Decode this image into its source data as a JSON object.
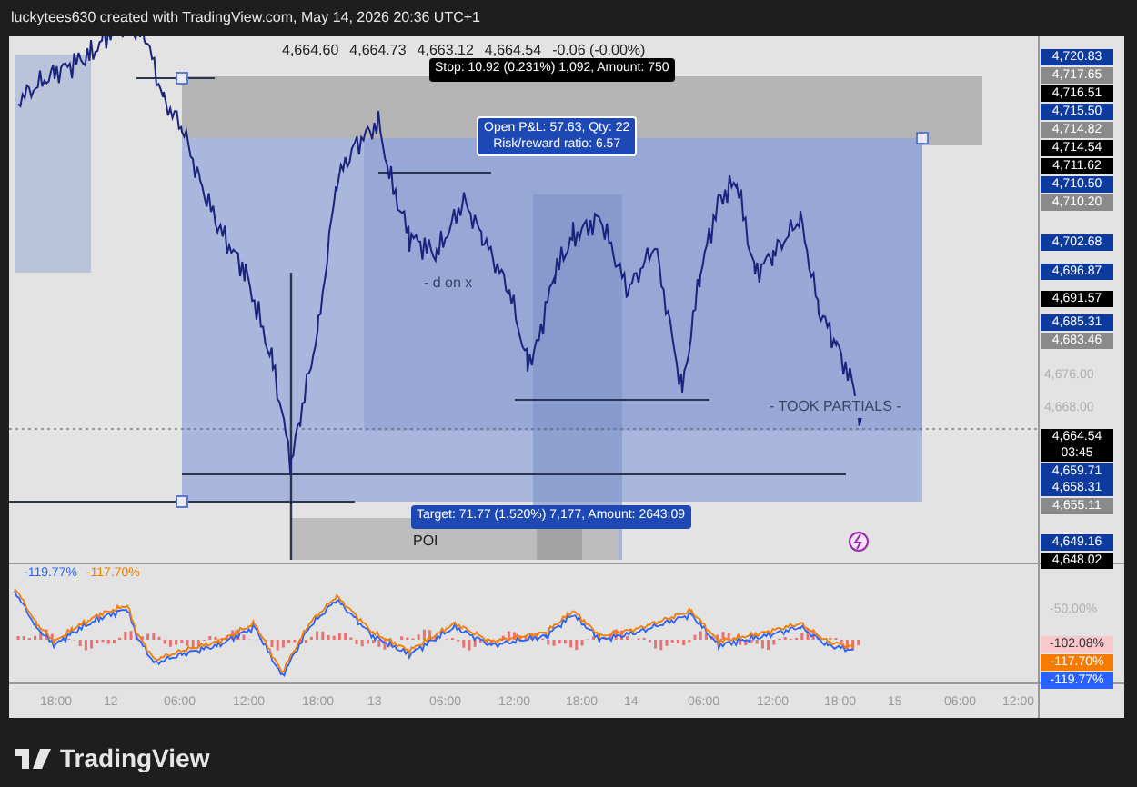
{
  "header": {
    "title": "luckytees630 created with TradingView.com, May 14, 2026 20:36 UTC+1"
  },
  "ohlc": [
    "4,664.60",
    "4,664.73",
    "4,663.12",
    "4,664.54",
    "-0.06 (-0.00%)"
  ],
  "annotations": {
    "stop": "Stop: 10.92 (0.231%) 1,092, Amount: 750",
    "open_pnl": "Open P&L: 57.63, Qty: 22",
    "risk_reward": "Risk/reward ratio: 6.57",
    "target": "Target: 71.77 (1.520%) 7,177, Amount: 2643.09",
    "note_left": "- d on x",
    "note_right": "- TOOK PARTIALS -",
    "zone": "POI"
  },
  "price_axis": [
    {
      "kind": "tag",
      "text": "4,720.83",
      "color": "#0d3a9e"
    },
    {
      "kind": "tag",
      "text": "4,717.65",
      "color": "#8a8a8a"
    },
    {
      "kind": "tag",
      "text": "4,716.51",
      "color": "#000000"
    },
    {
      "kind": "tag",
      "text": "4,715.50",
      "color": "#0d3a9e"
    },
    {
      "kind": "tag",
      "text": "4,714.82",
      "color": "#8a8a8a"
    },
    {
      "kind": "tag",
      "text": "4,714.54",
      "color": "#000000"
    },
    {
      "kind": "tag",
      "text": "4,711.62",
      "color": "#000000"
    },
    {
      "kind": "tag",
      "text": "4,710.50",
      "color": "#0d3a9e"
    },
    {
      "kind": "tag",
      "text": "4,710.20",
      "color": "#8a8a8a"
    },
    {
      "kind": "tag",
      "text": "4,702.68",
      "color": "#0d3a9e"
    },
    {
      "kind": "tag",
      "text": "4,696.87",
      "color": "#0d3a9e"
    },
    {
      "kind": "tag",
      "text": "4,691.57",
      "color": "#000000"
    },
    {
      "kind": "tag",
      "text": "4,685.31",
      "color": "#0d3a9e"
    },
    {
      "kind": "tag",
      "text": "4,683.46",
      "color": "#8a8a8a"
    },
    {
      "kind": "tick",
      "text": "4,676.00"
    },
    {
      "kind": "tick",
      "text": "4,668.00"
    },
    {
      "kind": "tag",
      "text": "4,664.54",
      "countdown": "03:45",
      "color": "#000000"
    },
    {
      "kind": "tag",
      "text": "4,659.71",
      "color": "#0d3a9e"
    },
    {
      "kind": "tag",
      "text": "4,658.31",
      "color": "#0d3a9e"
    },
    {
      "kind": "tag",
      "text": "4,655.11",
      "color": "#8a8a8a"
    },
    {
      "kind": "tag",
      "text": "4,649.16",
      "color": "#0d3a9e"
    },
    {
      "kind": "tag",
      "text": "4,648.02",
      "color": "#000000"
    }
  ],
  "macd": {
    "values": [
      {
        "text": "-119.77%",
        "color": "#2962ff"
      },
      {
        "text": "-117.70%",
        "color": "#f57c00"
      }
    ],
    "axis": [
      {
        "kind": "tick",
        "text": "-50.00%"
      },
      {
        "kind": "tag",
        "text": "-102.08%",
        "color": "#f8c8cc"
      },
      {
        "kind": "tag",
        "text": "-117.70%",
        "color": "#f57c00"
      },
      {
        "kind": "tag",
        "text": "-119.77%",
        "color": "#2962ff"
      }
    ]
  },
  "time_axis": [
    "18:00",
    "12",
    "06:00",
    "12:00",
    "18:00",
    "13",
    "06:00",
    "12:00",
    "18:00",
    "14",
    "06:00",
    "12:00",
    "18:00",
    "15",
    "06:00",
    "12:00"
  ],
  "footer": {
    "brand": "TradingView"
  }
}
